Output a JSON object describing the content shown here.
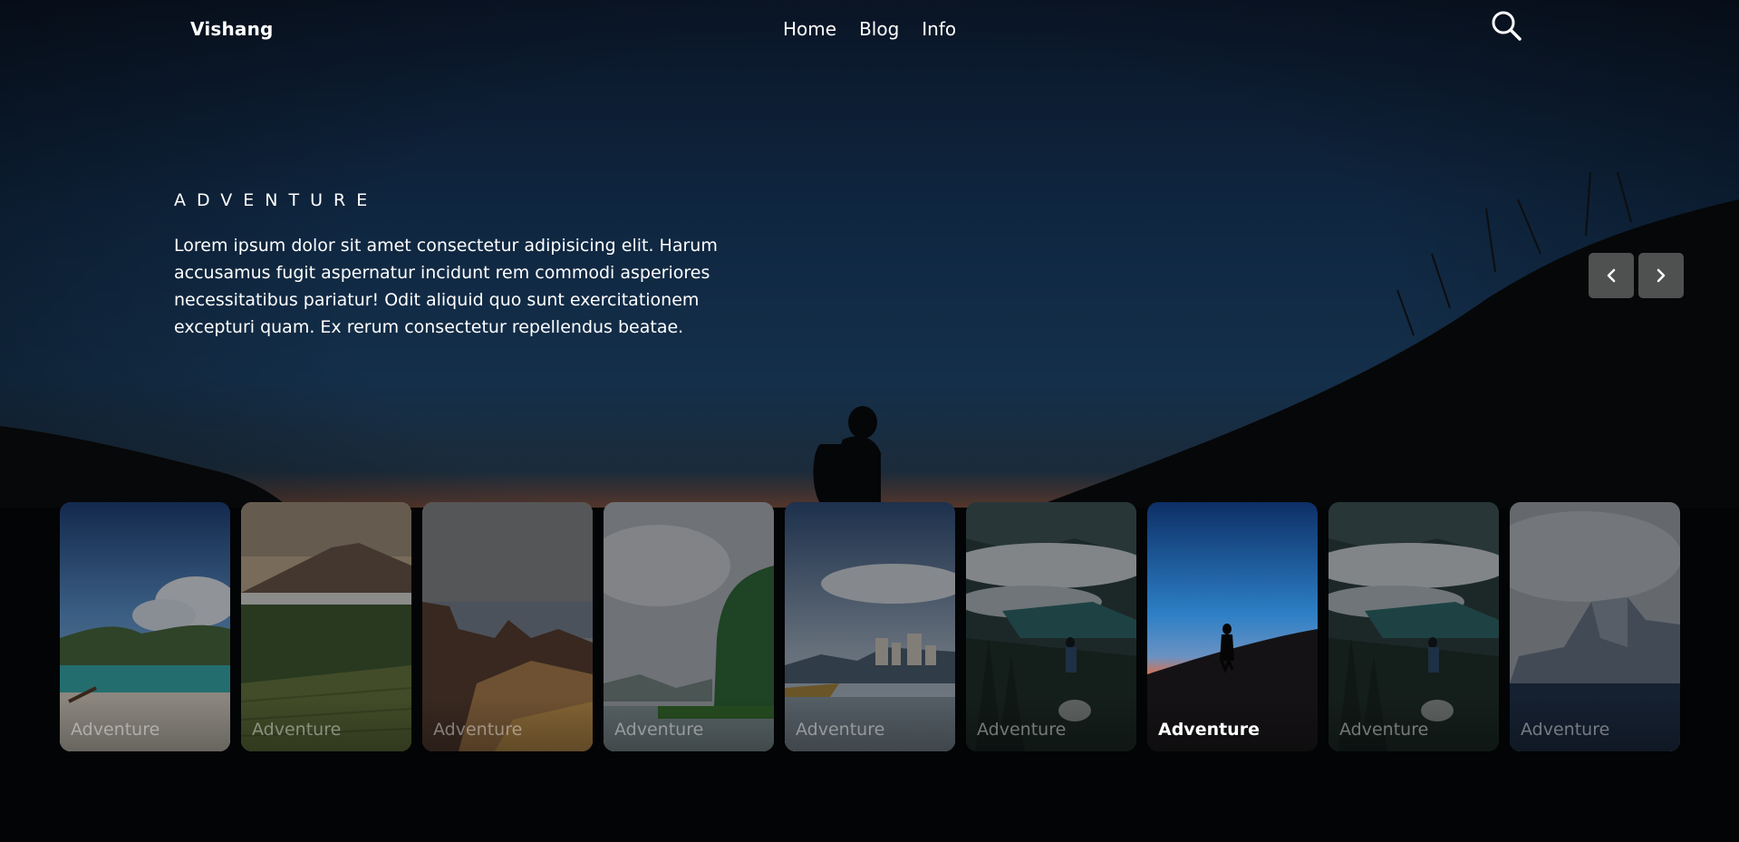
{
  "brand": "Vishang",
  "nav": {
    "links": [
      "Home",
      "Blog",
      "Info"
    ]
  },
  "hero": {
    "eyebrow": "ADVENTURE",
    "description": "Lorem ipsum dolor sit amet consectetur adipisicing elit. Harum accusamus fugit aspernatur incidunt rem commodi asperiores necessitatibus pariatur! Odit aliquid quo sunt exercitationem excepturi quam. Ex rerum consectetur repellendus beatae."
  },
  "controls": {
    "prev_icon": "chevron-left-icon",
    "next_icon": "chevron-right-icon",
    "search_icon": "search-icon"
  },
  "cards": [
    {
      "label": "Adventure",
      "scene": "beach",
      "active": false
    },
    {
      "label": "Adventure",
      "scene": "volcano",
      "active": false
    },
    {
      "label": "Adventure",
      "scene": "rocks",
      "active": false
    },
    {
      "label": "Adventure",
      "scene": "cliff",
      "active": false
    },
    {
      "label": "Adventure",
      "scene": "town",
      "active": false
    },
    {
      "label": "Adventure",
      "scene": "valley-hiker",
      "active": false
    },
    {
      "label": "Adventure",
      "scene": "sunset-hiker",
      "active": true
    },
    {
      "label": "Adventure",
      "scene": "valley-hiker",
      "active": false
    },
    {
      "label": "Adventure",
      "scene": "iceberg",
      "active": false
    }
  ],
  "colors": {
    "sky_top": "#0b1a33",
    "sky_mid": "#12304d",
    "horizon_glow": "#c0562a",
    "ground": "#030405"
  }
}
